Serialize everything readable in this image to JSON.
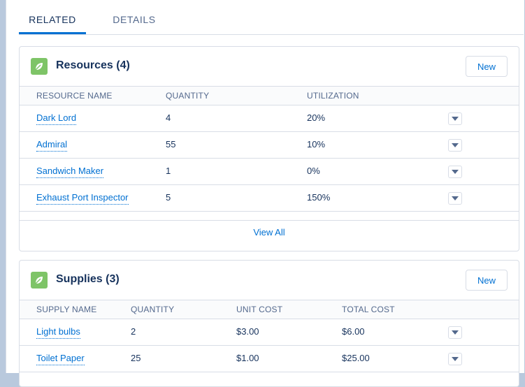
{
  "tabs": [
    {
      "label": "RELATED",
      "active": true
    },
    {
      "label": "DETAILS",
      "active": false
    }
  ],
  "resources": {
    "title": "Resources (4)",
    "new_label": "New",
    "columns": [
      "RESOURCE NAME",
      "QUANTITY",
      "UTILIZATION"
    ],
    "rows": [
      {
        "name": "Dark Lord",
        "quantity": "4",
        "utilization": "20%"
      },
      {
        "name": "Admiral",
        "quantity": "55",
        "utilization": "10%"
      },
      {
        "name": "Sandwich Maker",
        "quantity": "1",
        "utilization": "0%"
      },
      {
        "name": "Exhaust Port Inspector",
        "quantity": "5",
        "utilization": "150%"
      }
    ],
    "view_all": "View All"
  },
  "supplies": {
    "title": "Supplies (3)",
    "new_label": "New",
    "columns": [
      "SUPPLY NAME",
      "QUANTITY",
      "UNIT COST",
      "TOTAL COST"
    ],
    "rows": [
      {
        "name": "Light bulbs",
        "quantity": "2",
        "unit_cost": "$3.00",
        "total_cost": "$6.00"
      },
      {
        "name": "Toilet Paper",
        "quantity": "25",
        "unit_cost": "$1.00",
        "total_cost": "$25.00"
      }
    ]
  },
  "colors": {
    "accent": "#0070d2",
    "icon_green": "#7ec467",
    "text": "#16325c",
    "muted": "#54698d"
  },
  "icons": {
    "card_icon": "leaf-icon",
    "row_menu": "chevron-down-icon"
  }
}
